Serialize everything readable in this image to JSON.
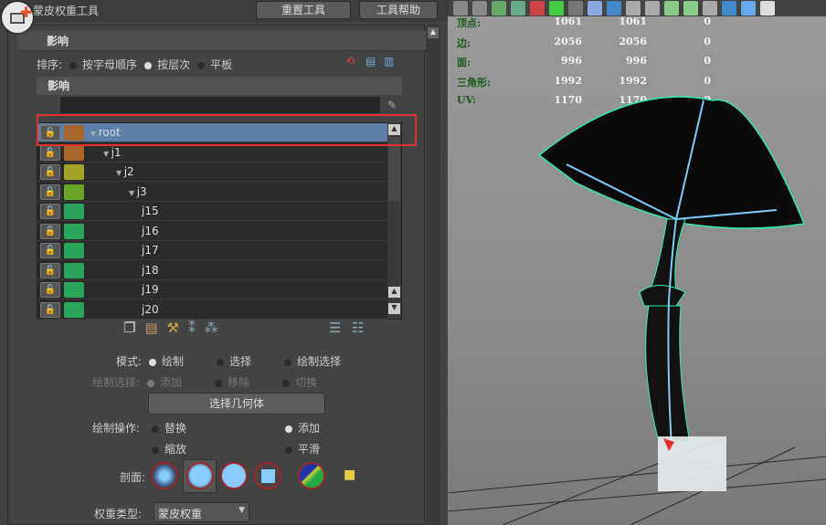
{
  "window": {
    "title": "蒙皮权重工具",
    "reset_button": "重置工具",
    "help_button": "工具帮助"
  },
  "section": {
    "title": "影响"
  },
  "sort": {
    "label": "排序:",
    "options": [
      "按字母顺序",
      "按层次",
      "平板"
    ],
    "selected": "按层次"
  },
  "influence": {
    "header": "影响",
    "filter_value": ""
  },
  "joints": [
    {
      "name": "root",
      "color": "#a8672a",
      "indent": 0,
      "expanded": true,
      "selected": true
    },
    {
      "name": "j1",
      "color": "#a8672a",
      "indent": 1,
      "expanded": true
    },
    {
      "name": "j2",
      "color": "#a3a32a",
      "indent": 2,
      "expanded": true
    },
    {
      "name": "j3",
      "color": "#6aa52a",
      "indent": 3,
      "expanded": true
    },
    {
      "name": "j15",
      "color": "#2aa55a",
      "indent": 4
    },
    {
      "name": "j16",
      "color": "#2aa55a",
      "indent": 4
    },
    {
      "name": "j17",
      "color": "#2aa55a",
      "indent": 4
    },
    {
      "name": "j18",
      "color": "#2aa55a",
      "indent": 4
    },
    {
      "name": "j19",
      "color": "#2aa55a",
      "indent": 4
    },
    {
      "name": "j20",
      "color": "#2aa55a",
      "indent": 4
    }
  ],
  "mode": {
    "label": "模式:",
    "options": [
      "绘制",
      "选择",
      "绘制选择"
    ],
    "selected": "绘制"
  },
  "paint_select": {
    "label": "绘制选择:",
    "options": [
      "添加",
      "移除",
      "切换"
    ],
    "selected": "添加"
  },
  "select_geometry_button": "选择几何体",
  "paint_operation": {
    "label": "绘制操作:",
    "options": [
      "替换",
      "添加",
      "缩放",
      "平滑"
    ],
    "selected": "添加"
  },
  "profile": {
    "label": "剖面:",
    "selected": 1
  },
  "weight_type": {
    "label": "权重类型:",
    "value": "蒙皮权重"
  },
  "hud": {
    "rows": [
      {
        "label": "顶点:",
        "values": [
          "1061",
          "1061",
          "0"
        ]
      },
      {
        "label": "边:",
        "values": [
          "2056",
          "2056",
          "0"
        ]
      },
      {
        "label": "面:",
        "values": [
          "996",
          "996",
          "0"
        ]
      },
      {
        "label": "三角形:",
        "values": [
          "1992",
          "1992",
          "0"
        ]
      },
      {
        "label": "UV:",
        "values": [
          "1170",
          "1170",
          "0"
        ]
      }
    ]
  },
  "colors": {
    "highlight": "#e53030",
    "selection": "#5d7fa8",
    "wireframe": "#2cf0b0"
  }
}
